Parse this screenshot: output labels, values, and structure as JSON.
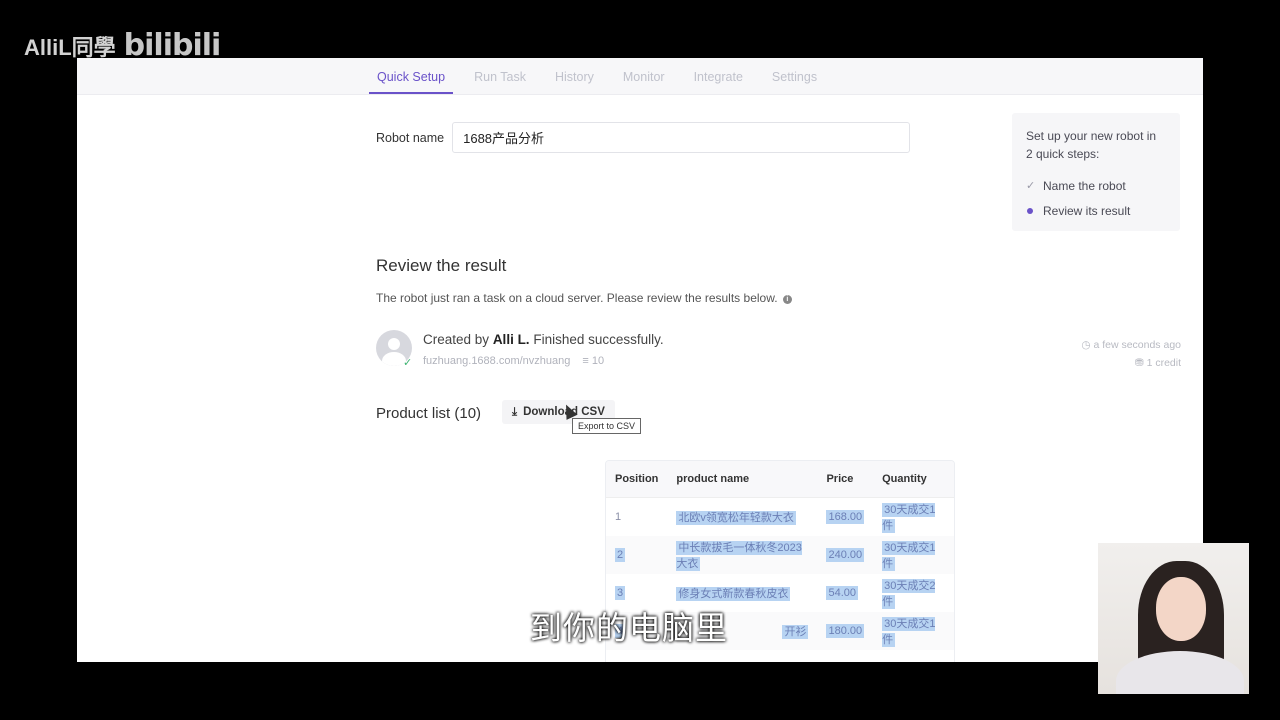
{
  "watermark": {
    "channel": "AlliL同學",
    "platform": "bilibili"
  },
  "tabs": [
    "Quick Setup",
    "Run Task",
    "History",
    "Monitor",
    "Integrate",
    "Settings"
  ],
  "robot": {
    "label": "Robot name",
    "value": "1688产品分析"
  },
  "steps": {
    "title": "Set up your new robot in 2 quick steps:",
    "items": [
      {
        "label": "Name the robot",
        "state": "done"
      },
      {
        "label": "Review its result",
        "state": "current"
      }
    ]
  },
  "review": {
    "title": "Review the result",
    "subtitle": "The robot just ran a task on a cloud server. Please review the results below."
  },
  "task": {
    "created_prefix": "Created by",
    "author": "Alli L.",
    "status": "Finished successfully.",
    "url": "fuzhuang.1688.com/nvzhuang",
    "count": "10",
    "time": "a few seconds ago",
    "credits": "1 credit"
  },
  "product_list": {
    "title": "Product list (10)",
    "download_label": "Download CSV",
    "tooltip": "Export to CSV"
  },
  "table": {
    "headers": [
      "Position",
      "product name",
      "Price",
      "Quantity"
    ],
    "rows": [
      [
        "1",
        "北欧v领宽松年轻款大衣",
        "168.00",
        "30天成交1件"
      ],
      [
        "2",
        "中长款拔毛一体秋冬2023大衣",
        "240.00",
        "30天成交1件"
      ],
      [
        "3",
        "修身女式新款春秋皮衣",
        "54.00",
        "30天成交2件"
      ],
      [
        "4",
        "开衫",
        "180.00",
        "30天成交1件"
      ]
    ]
  },
  "subtitle": "到你的电脑里",
  "colors": {
    "accent": "#6a52c9",
    "highlight": "#b7d3f2",
    "success": "#3cb371"
  }
}
